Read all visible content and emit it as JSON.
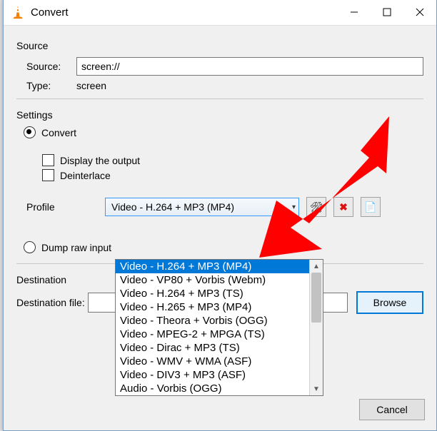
{
  "window": {
    "title": "Convert"
  },
  "source": {
    "group_label": "Source",
    "source_label": "Source:",
    "source_value": "screen://",
    "type_label": "Type:",
    "type_value": "screen"
  },
  "settings": {
    "group_label": "Settings",
    "convert_label": "Convert",
    "display_output_label": "Display the output",
    "deinterlace_label": "Deinterlace",
    "profile_label": "Profile",
    "profile_selected": "Video - H.264 + MP3 (MP4)",
    "profile_options": [
      "Video - H.264 + MP3 (MP4)",
      "Video - VP80 + Vorbis (Webm)",
      "Video - H.264 + MP3 (TS)",
      "Video - H.265 + MP3 (MP4)",
      "Video - Theora + Vorbis (OGG)",
      "Video - MPEG-2 + MPGA (TS)",
      "Video - Dirac + MP3 (TS)",
      "Video - WMV + WMA (ASF)",
      "Video - DIV3 + MP3 (ASF)",
      "Audio - Vorbis (OGG)"
    ],
    "dump_label": "Dump raw input"
  },
  "destination": {
    "group_label": "Destination",
    "file_label": "Destination file:",
    "browse_label": "Browse"
  },
  "footer": {
    "cancel_label": "Cancel"
  },
  "icons": {
    "edit": "🛠",
    "delete": "✖",
    "new": "📄"
  }
}
